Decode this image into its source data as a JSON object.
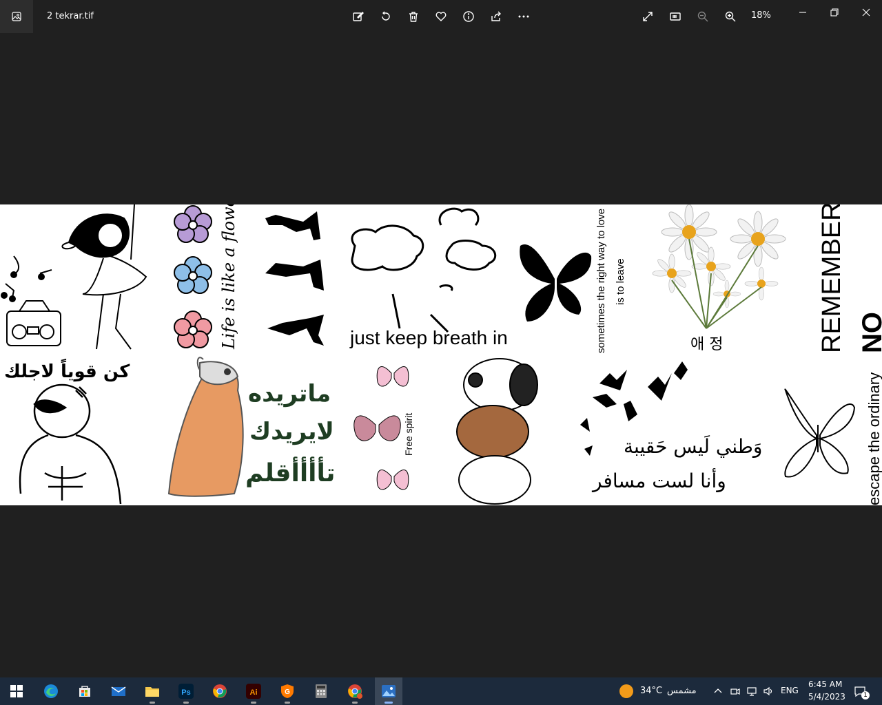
{
  "window": {
    "title": "2 tekrar.tif",
    "zoom": "18%"
  },
  "toolbar": {
    "icons": [
      "edit-icon",
      "rotate-icon",
      "delete-icon",
      "favorite-icon",
      "info-icon",
      "share-icon",
      "more-icon"
    ],
    "right_icons": [
      "fullscreen-icon",
      "actual-size-icon",
      "zoom-out-icon",
      "zoom-in-icon"
    ]
  },
  "image": {
    "texts": {
      "life_flower": "Life is like a flower",
      "keep_breath": "just keep breath in",
      "right_way_1": "sometimes the right way to love",
      "right_way_2": "is to leave",
      "korean": "애 정",
      "remember": "REMEMBER?",
      "no": "NO",
      "arabic_strong": "كن قوياً لاجلك",
      "arabic_want_1": "ماتريده",
      "arabic_want_2": "لايريدك",
      "arabic_want_3": "تأأأأقلم",
      "free_spirit": "Free spirit",
      "arabic_home_1": "وَطني لَيس حَقيبة",
      "arabic_home_2": "وأنا لست مسافر",
      "escape": "escape the ordinary"
    }
  },
  "taskbar": {
    "apps": [
      "windows-start",
      "edge",
      "store",
      "mail",
      "file-explorer",
      "photoshop",
      "chrome",
      "illustrator",
      "gpu-app",
      "calculator",
      "chrome-profile",
      "photos"
    ],
    "weather_temp": "34°C",
    "weather_text": "مشمس",
    "lang": "ENG",
    "time": "6:45 AM",
    "date": "5/4/2023",
    "notif_count": "1"
  },
  "colors": {
    "titlebar": "#202020",
    "taskbar": "#1c2a3c",
    "accent": "#8ab4f8"
  }
}
